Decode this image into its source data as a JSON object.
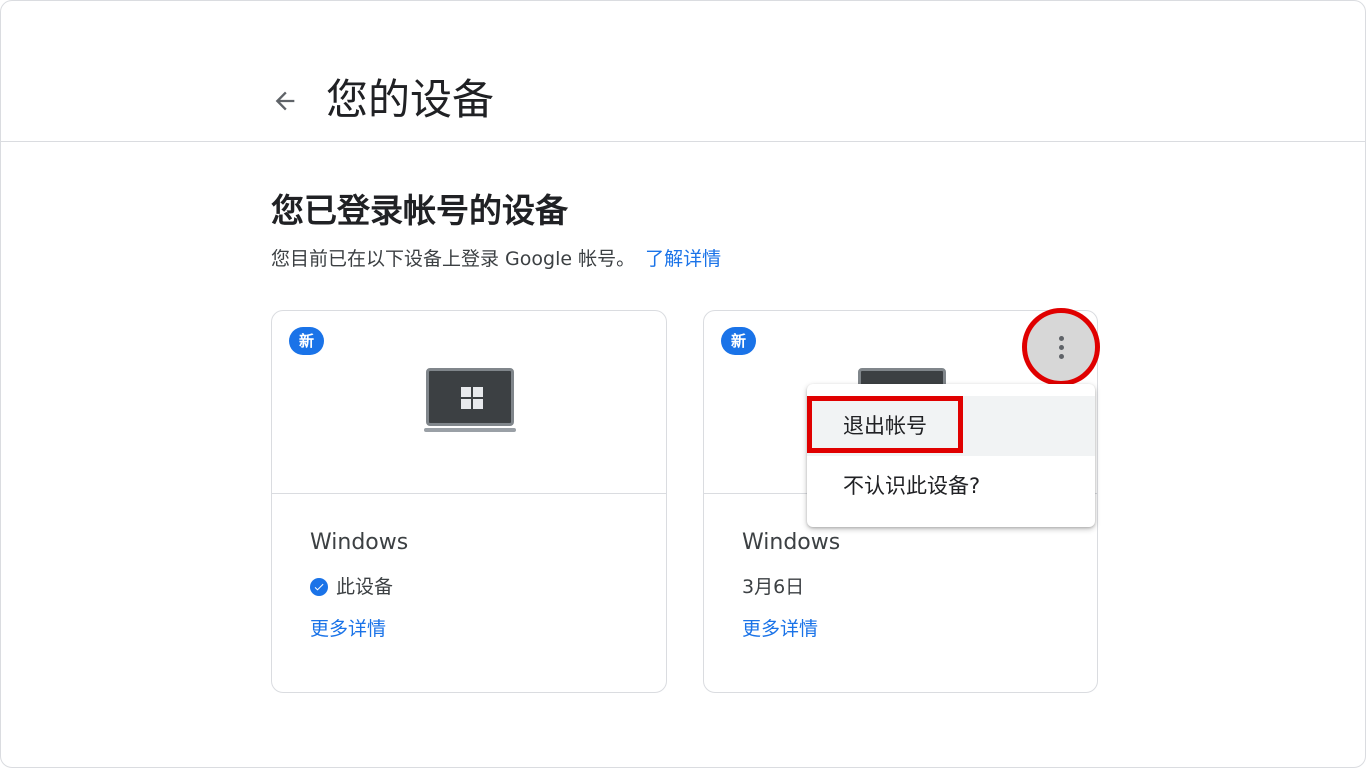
{
  "header": {
    "title": "您的设备"
  },
  "section": {
    "title": "您已登录帐号的设备",
    "description": "您目前已在以下设备上登录 Google 帐号。",
    "learn_more": "了解详情"
  },
  "devices": [
    {
      "badge": "新",
      "name": "Windows",
      "status": "此设备",
      "more_details": "更多详情"
    },
    {
      "badge": "新",
      "name": "Windows",
      "status": "3月6日",
      "more_details": "更多详情"
    }
  ],
  "menu": {
    "items": [
      {
        "label": "退出帐号"
      },
      {
        "label": "不认识此设备?"
      }
    ]
  },
  "colors": {
    "accent": "#1a73e8",
    "annotation": "#e00000",
    "border": "#dadce0"
  }
}
